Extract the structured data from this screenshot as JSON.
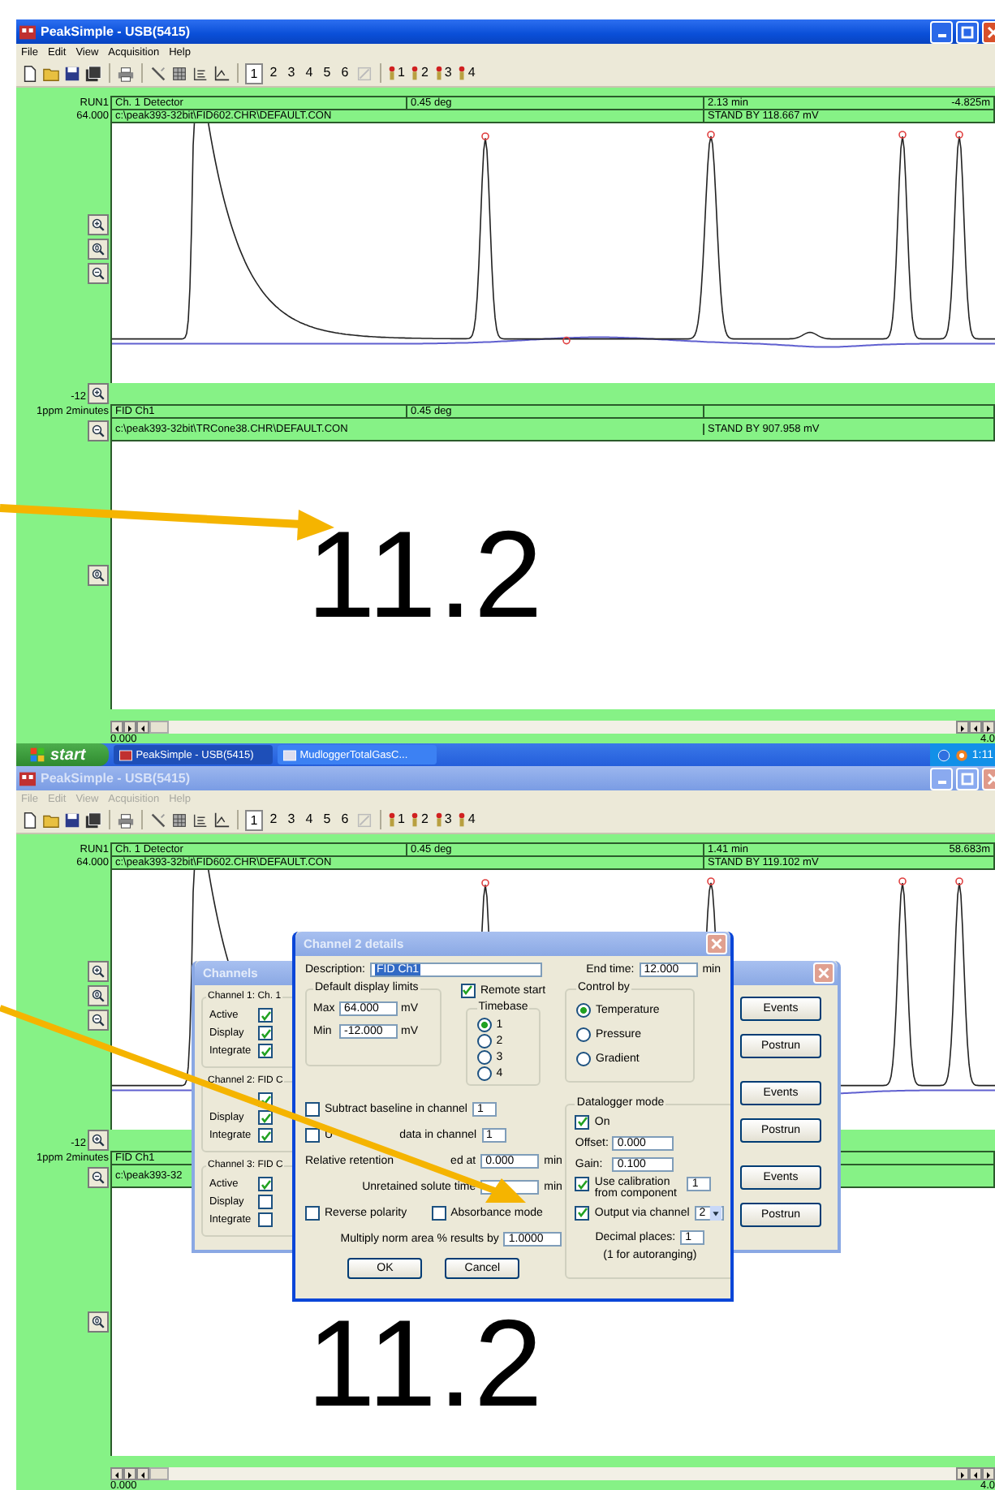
{
  "screens": [
    {
      "window": {
        "title": "PeakSimple - USB(5415)",
        "active": true
      },
      "menu": [
        "File",
        "Edit",
        "View",
        "Acquisition",
        "Help"
      ],
      "toolbar": {
        "views": [
          {
            "label": "1",
            "selected": true
          },
          {
            "label": "2",
            "selected": false
          },
          {
            "label": "3",
            "selected": false
          },
          {
            "label": "4",
            "selected": false
          },
          {
            "label": "5",
            "selected": false
          },
          {
            "label": "6",
            "selected": false
          }
        ],
        "channel_buttons": [
          "1",
          "2",
          "3",
          "4"
        ]
      },
      "chart": {
        "run_label": "RUN1",
        "scale_max": "64.000",
        "scale_min": "-12",
        "header": {
          "description": "Ch. 1 Detector",
          "temperature": "0.45 deg",
          "time": "2.13 min",
          "reading": "-4.825m",
          "file": "c:\\peak393-32bit\\FID602.CHR\\DEFAULT.CON",
          "status": "STAND BY 118.667 mV"
        }
      },
      "reading_panel": {
        "label": "1ppm 2minutes",
        "header": {
          "description": "FID Ch1",
          "temperature": "0.45 deg",
          "file": "c:\\peak393-32bit\\TRCone38.CHR\\DEFAULT.CON",
          "status": "STAND BY 907.958 mV"
        },
        "value": "11.2"
      },
      "axis": {
        "start": "0.000",
        "end": "4.0"
      },
      "taskbar": {
        "start": "start",
        "tasks": [
          {
            "label": "PeakSimple - USB(5415)",
            "selected": true
          },
          {
            "label": "MudloggerTotalGasC...",
            "selected": false
          }
        ],
        "clock": "1:11"
      }
    },
    {
      "window": {
        "title": "PeakSimple - USB(5415)",
        "active": false
      },
      "menu": [
        "File",
        "Edit",
        "View",
        "Acquisition",
        "Help"
      ],
      "toolbar": {
        "views": [
          {
            "label": "1",
            "selected": true
          },
          {
            "label": "2",
            "selected": false
          },
          {
            "label": "3",
            "selected": false
          },
          {
            "label": "4",
            "selected": false
          },
          {
            "label": "5",
            "selected": false
          },
          {
            "label": "6",
            "selected": false
          }
        ],
        "channel_buttons": [
          "1",
          "2",
          "3",
          "4"
        ]
      },
      "chart": {
        "run_label": "RUN1",
        "scale_max": "64.000",
        "scale_min": "-12",
        "header": {
          "description": "Ch. 1 Detector",
          "temperature": "0.45 deg",
          "time": "1.41 min",
          "reading": "58.683m",
          "file": "c:\\peak393-32bit\\FID602.CHR\\DEFAULT.CON",
          "status": "STAND BY 119.102 mV"
        }
      },
      "reading_panel": {
        "label": "1ppm 2minutes",
        "header": {
          "description": "FID Ch1",
          "file": "c:\\peak393-32"
        },
        "value": "11.2"
      },
      "axis": {
        "start": "0.000",
        "end": "4.0"
      },
      "dialogs": [
        {
          "kind": "channels",
          "title": "Channels",
          "active": false,
          "groups": [
            {
              "title": "Channel 1: Ch. 1",
              "options": [
                {
                  "label": "Active",
                  "checked": true
                },
                {
                  "label": "Display",
                  "checked": true
                },
                {
                  "label": "Integrate",
                  "checked": true
                }
              ],
              "buttons": [
                "Events",
                "Postrun"
              ]
            },
            {
              "title": "Channel 2: FID C",
              "options": [
                {
                  "checked": true
                },
                {
                  "label": "Display",
                  "checked": true
                },
                {
                  "label": "Integrate",
                  "checked": true
                }
              ],
              "buttons": [
                "Events",
                "Postrun"
              ]
            },
            {
              "title": "Channel 3: FID C",
              "options": [
                {
                  "label": "Active",
                  "checked": true
                },
                {
                  "label": "Display",
                  "checked": false
                },
                {
                  "label": "Integrate",
                  "checked": false
                }
              ],
              "buttons": [
                "Events",
                "Postrun"
              ]
            }
          ]
        },
        {
          "kind": "details",
          "title": "Channel 2 details",
          "active": true,
          "description": {
            "label": "Description:",
            "value": "FID Ch1"
          },
          "end_time": {
            "label": "End time:",
            "value": "12.000",
            "unit": "min"
          },
          "display_limits": {
            "title": "Default display limits",
            "rows": [
              {
                "label": "Max",
                "value": "64.000",
                "unit": "mV"
              },
              {
                "label": "Min",
                "value": "-12.000",
                "unit": "mV"
              }
            ]
          },
          "remote_start": {
            "label": "Remote start",
            "checked": true
          },
          "timebase": {
            "title": "Timebase",
            "options": [
              {
                "label": "1",
                "selected": true
              },
              {
                "label": "2",
                "selected": false
              },
              {
                "label": "3",
                "selected": false
              },
              {
                "label": "4",
                "selected": false
              }
            ]
          },
          "control_by": {
            "title": "Control by",
            "options": [
              {
                "label": "Temperature",
                "selected": true
              },
              {
                "label": "Pressure",
                "selected": false
              },
              {
                "label": "Gradient",
                "selected": false
              }
            ]
          },
          "rows": [
            {
              "kind": "check",
              "label": "Subtract baseline in channel",
              "checked": false,
              "value": "1"
            },
            {
              "kind": "check",
              "label": "U",
              "label_end": "data in channel",
              "checked": false,
              "value": "1"
            },
            {
              "kind": "field",
              "label": "Relative retention",
              "label_end": "ed at",
              "value": "0.000",
              "unit": "min"
            },
            {
              "kind": "field",
              "label": "Unretained solute time",
              "unit": "min"
            },
            {
              "kind": "checks",
              "items": [
                {
                  "label": "Reverse polarity",
                  "checked": false
                },
                {
                  "label": "Absorbance mode",
                  "checked": false
                }
              ]
            },
            {
              "kind": "field",
              "label": "Multiply norm area % results by",
              "value": "1.0000"
            }
          ],
          "buttons": [
            "OK",
            "Cancel"
          ],
          "datalogger": {
            "title": "Datalogger mode",
            "on": {
              "label": "On",
              "checked": true
            },
            "fields": [
              {
                "label": "Offset:",
                "value": "0.000"
              },
              {
                "label": "Gain:",
                "value": "0.100"
              }
            ],
            "calibration": {
              "label": "Use calibration from component",
              "checked": true,
              "value": "1"
            },
            "output": {
              "label": "Output via channel",
              "checked": true,
              "value": "2"
            },
            "decimal": {
              "label": "Decimal places:",
              "value": "1",
              "note": "(1 for autoranging)"
            }
          }
        }
      ]
    }
  ]
}
